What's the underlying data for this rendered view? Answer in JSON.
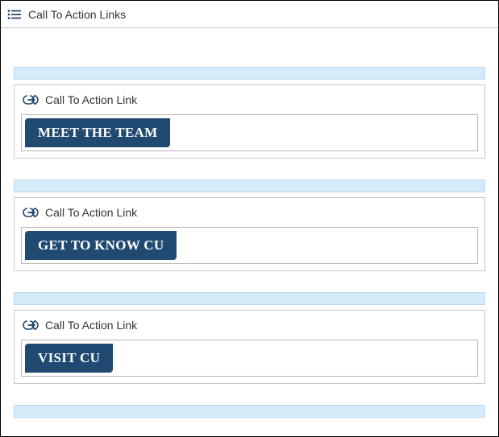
{
  "titlebar": {
    "title": "Call To Action Links"
  },
  "cta_label": "Call To Action Link",
  "items": [
    {
      "button_label": "MEET THE TEAM"
    },
    {
      "button_label": "GET TO KNOW CU"
    },
    {
      "button_label": "VISIT CU"
    }
  ]
}
